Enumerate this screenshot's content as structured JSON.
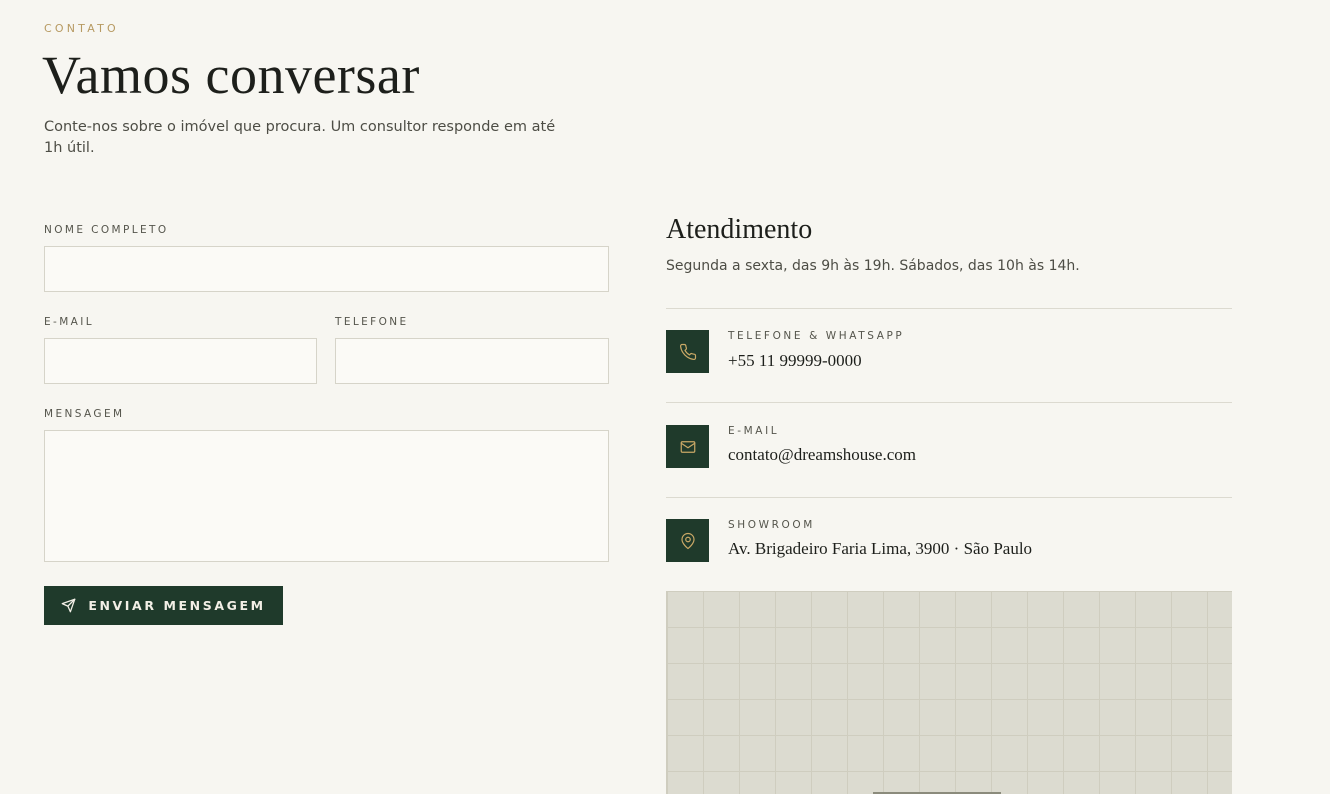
{
  "header": {
    "eyebrow": "CONTATO",
    "title": "Vamos conversar",
    "intro": "Conte-nos sobre o imóvel que procura. Um consultor responde em até 1h útil."
  },
  "form": {
    "name_label": "NOME COMPLETO",
    "name_value": "",
    "email_label": "E-MAIL",
    "email_value": "",
    "phone_label": "TELEFONE",
    "phone_value": "",
    "message_label": "MENSAGEM",
    "message_value": "",
    "submit_label": "ENVIAR MENSAGEM",
    "submit_icon": "send-icon"
  },
  "service": {
    "title": "Atendimento",
    "hours": "Segunda a sexta, das 9h às 19h. Sábados, das 10h às 14h.",
    "items": [
      {
        "icon": "phone-icon",
        "label": "TELEFONE & WHATSAPP",
        "value": "+55 11 99999-0000"
      },
      {
        "icon": "mail-icon",
        "label": "E-MAIL",
        "value": "contato@dreamshouse.com"
      },
      {
        "icon": "map-pin-icon",
        "label": "SHOWROOM",
        "value": "Av. Brigadeiro Faria Lima, 3900 · São Paulo"
      }
    ]
  },
  "colors": {
    "background": "#f7f6f1",
    "accent_green": "#1f3a2b",
    "eyebrow_gold": "#b79a62",
    "icon_gold": "#c9a866"
  }
}
